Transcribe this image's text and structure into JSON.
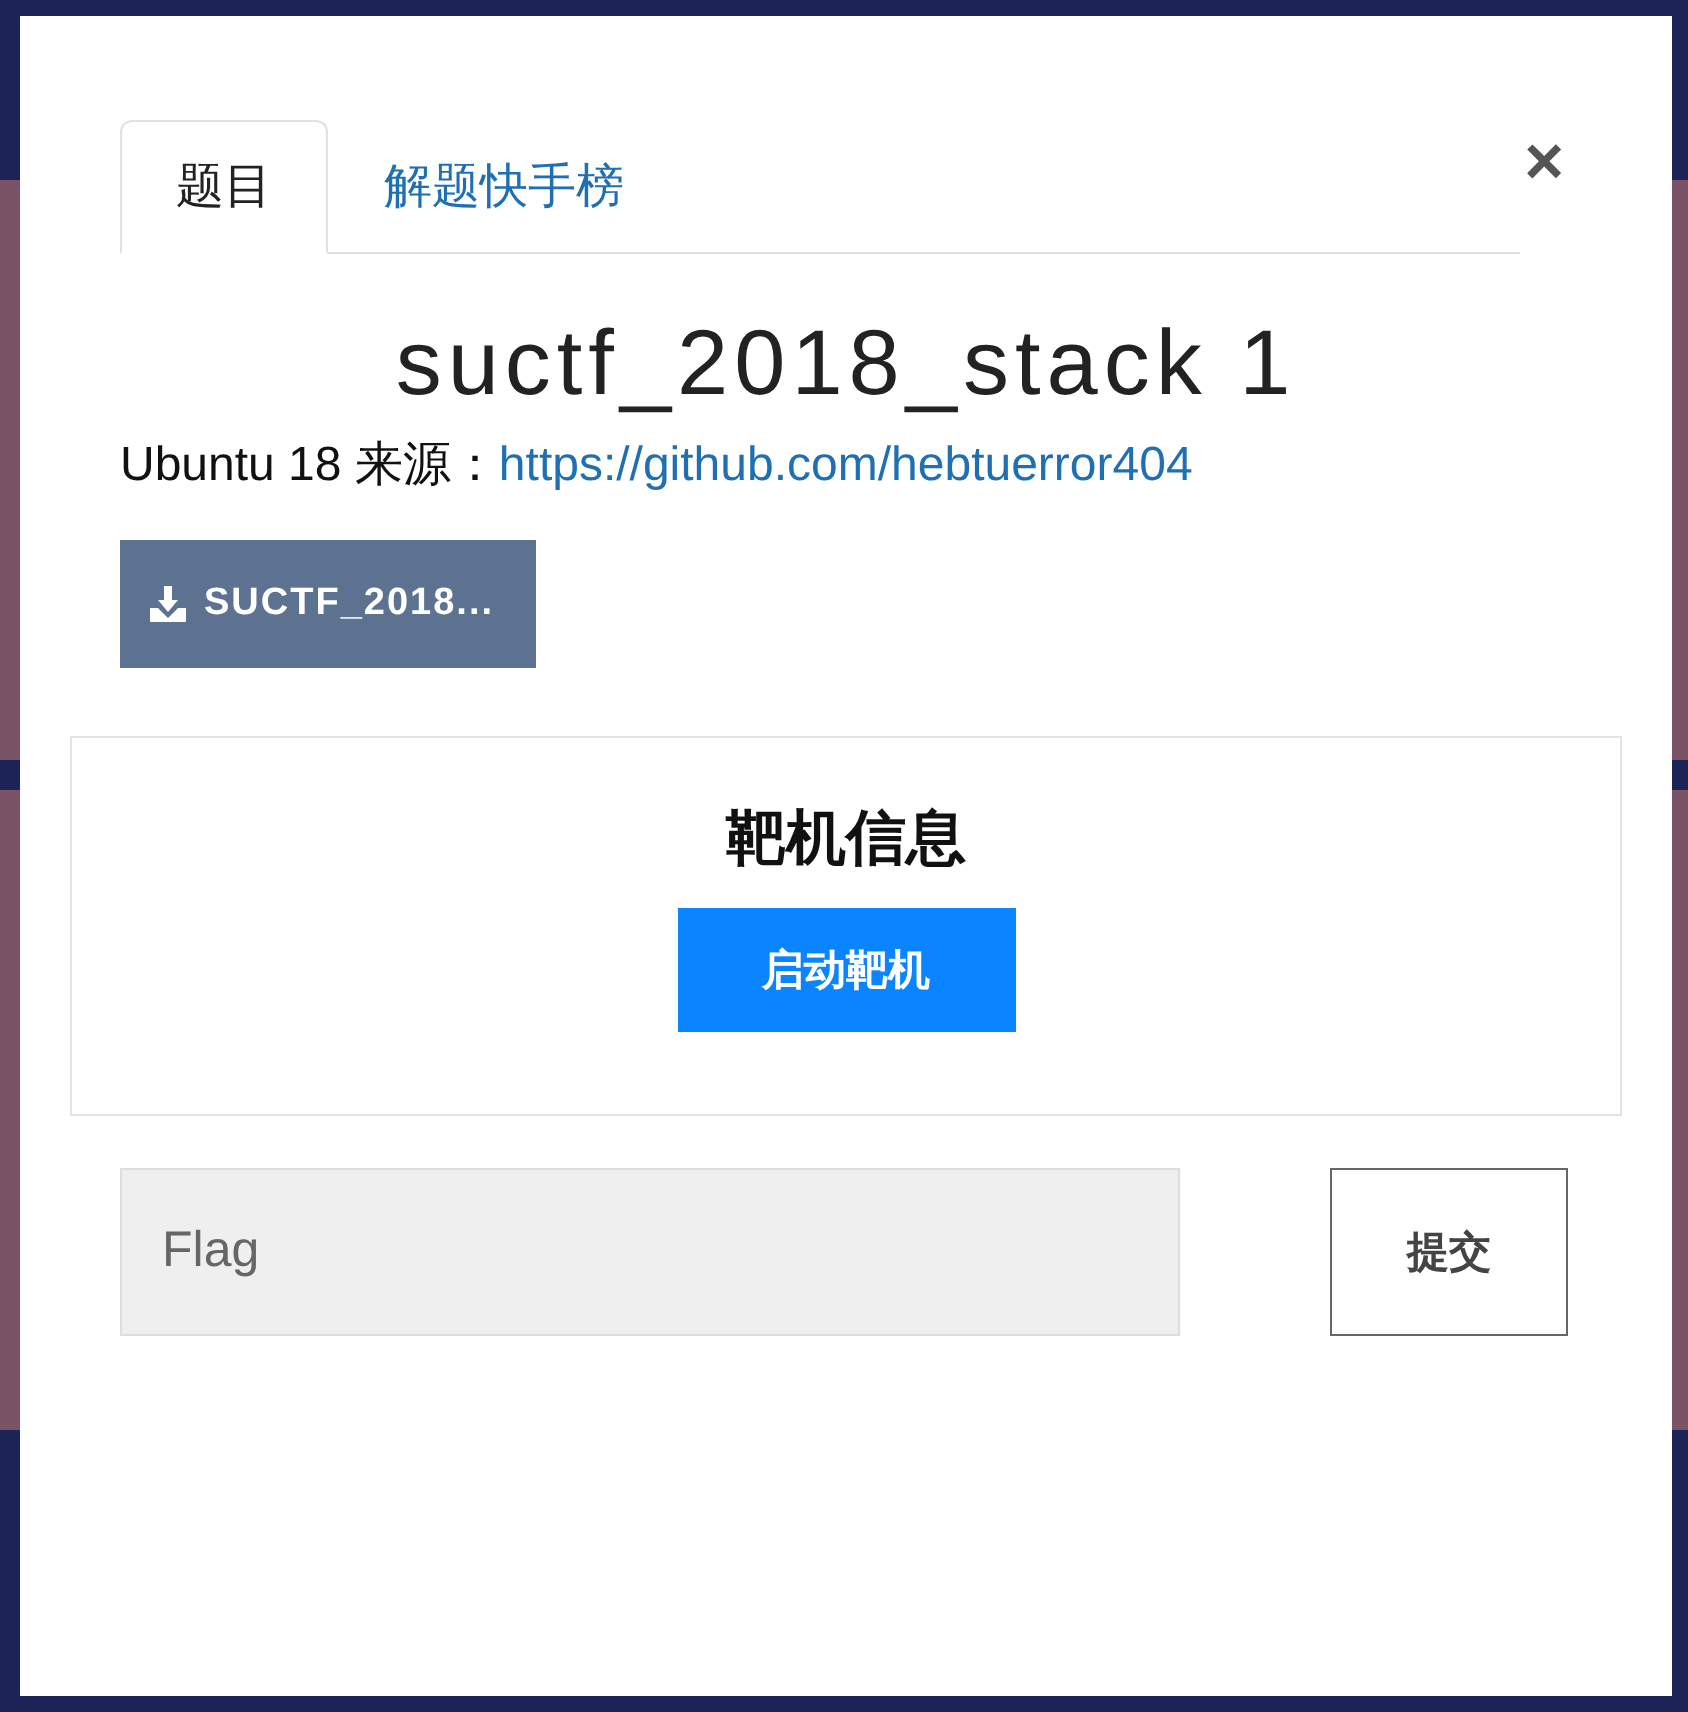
{
  "tabs": [
    {
      "label": "题目",
      "selected": true
    },
    {
      "label": "解题快手榜",
      "selected": false
    }
  ],
  "close": "×",
  "challenge": {
    "title": "suctf_2018_stack 1",
    "description": "Ubuntu 18 来源：",
    "link": "https://github.com/hebtuerror404",
    "download": "SUCTF_2018..."
  },
  "target": {
    "heading": "靶机信息",
    "start_button": "启动靶机"
  },
  "flag": {
    "placeholder": "Flag",
    "submit": "提交"
  }
}
